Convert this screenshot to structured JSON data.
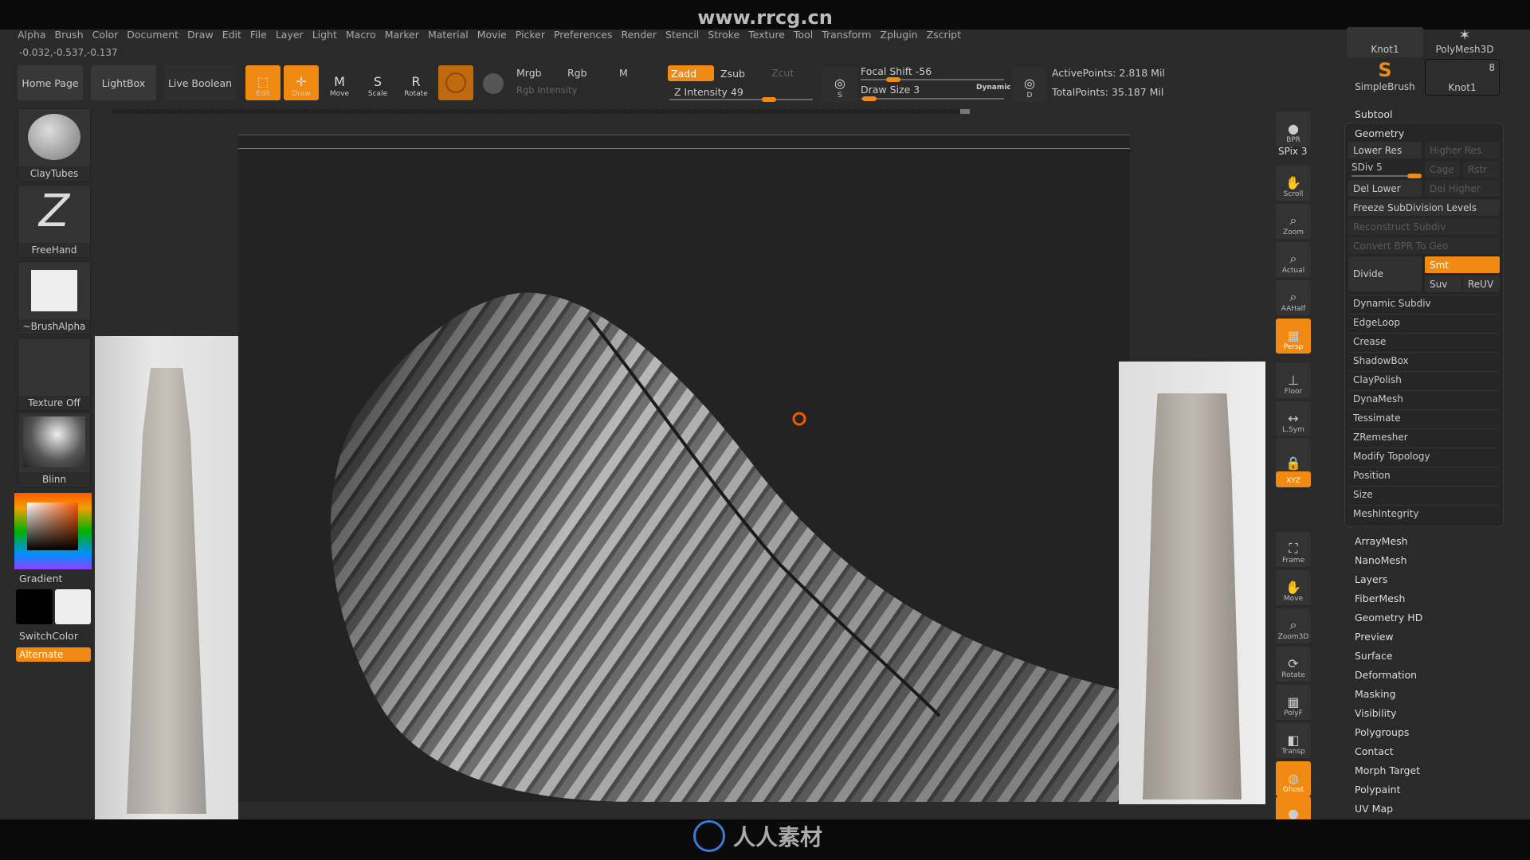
{
  "site": "www.rrcg.cn",
  "menu": [
    "Alpha",
    "Brush",
    "Color",
    "Document",
    "Draw",
    "Edit",
    "File",
    "Layer",
    "Light",
    "Macro",
    "Marker",
    "Material",
    "Movie",
    "Picker",
    "Preferences",
    "Render",
    "Stencil",
    "Stroke",
    "Texture",
    "Tool",
    "Transform",
    "Zplugin",
    "Zscript"
  ],
  "coords": "-0.032,-0.537,-0.137",
  "toolbar": {
    "home": "Home Page",
    "lightbox": "LightBox",
    "liveboolean": "Live Boolean",
    "edit": "Edit",
    "draw": "Draw",
    "move": "Move",
    "scale": "Scale",
    "rotate": "Rotate",
    "mrgb": "Mrgb",
    "rgb": "Rgb",
    "m": "M",
    "rgb_intensity": "Rgb Intensity",
    "zadd": "Zadd",
    "zsub": "Zsub",
    "zcut": "Zcut",
    "z_intensity": "Z Intensity 49",
    "focal_shift": "Focal Shift -56",
    "draw_size": "Draw Size 3",
    "dynamic": "Dynamic",
    "s": "S",
    "d": "D",
    "active_points": "ActivePoints: 2.818 Mil",
    "total_points": "TotalPoints: 35.187 Mil",
    "z_intensity_value": 49,
    "focal_shift_value": -56,
    "draw_size_value": 3
  },
  "left_shelf": {
    "brush": "ClayTubes",
    "stroke": "FreeHand",
    "alpha": "~BrushAlpha",
    "texture": "Texture Off",
    "material": "Blinn",
    "gradient": "Gradient",
    "switchcolor": "SwitchColor",
    "alternate": "Alternate"
  },
  "right_shelf": [
    {
      "label": "BPR",
      "icon": "bpr-icon"
    },
    {
      "label": "Scroll",
      "icon": "scroll-icon"
    },
    {
      "label": "Zoom",
      "icon": "zoom-icon"
    },
    {
      "label": "Actual",
      "icon": "actual-icon"
    },
    {
      "label": "AAHalf",
      "icon": "aahalf-icon"
    },
    {
      "label": "Persp",
      "icon": "persp-icon",
      "on": true
    },
    {
      "label": "Floor",
      "icon": "floor-icon"
    },
    {
      "label": "L.Sym",
      "icon": "lsym-icon"
    },
    {
      "label": "",
      "icon": "lock-icon"
    },
    {
      "label": "XYZ",
      "icon": "xyz-icon",
      "on": true
    },
    {
      "label": "Frame",
      "icon": "frame-icon"
    },
    {
      "label": "Move",
      "icon": "move-icon"
    },
    {
      "label": "Zoom3D",
      "icon": "zoom3d-icon"
    },
    {
      "label": "Rotate",
      "icon": "rotate-icon"
    },
    {
      "label": "PolyF",
      "icon": "polyf-icon"
    },
    {
      "label": "Transp",
      "icon": "transp-icon"
    },
    {
      "label": "Ghost",
      "icon": "ghost-icon",
      "on": true
    },
    {
      "label": "Solo",
      "icon": "solo-icon",
      "on": true
    }
  ],
  "spix": "SPix 3",
  "tools": {
    "knot1": "Knot1",
    "polymesh": "PolyMesh3D",
    "simplebrush": "SimpleBrush",
    "knot1b": "Knot1",
    "count": "8"
  },
  "subtool": "Subtool",
  "geometry": {
    "title": "Geometry",
    "lower_res": "Lower Res",
    "higher_res": "Higher Res",
    "sdiv": "SDiv 5",
    "sdiv_value": 5,
    "cage": "Cage",
    "rstr": "Rstr",
    "del_lower": "Del Lower",
    "del_higher": "Del Higher",
    "freeze": "Freeze SubDivision Levels",
    "reconstruct": "Reconstruct Subdiv",
    "convert": "Convert BPR To Geo",
    "divide": "Divide",
    "smt": "Smt",
    "suv": "Suv",
    "reuv": "ReUV",
    "items": [
      "Dynamic Subdiv",
      "EdgeLoop",
      "Crease",
      "ShadowBox",
      "ClayPolish",
      "DynaMesh",
      "Tessimate",
      "ZRemesher",
      "Modify Topology",
      "Position",
      "Size",
      "MeshIntegrity"
    ]
  },
  "tool_menu": [
    "ArrayMesh",
    "NanoMesh",
    "Layers",
    "FiberMesh",
    "Geometry HD",
    "Preview",
    "Surface",
    "Deformation",
    "Masking",
    "Visibility",
    "Polygroups",
    "Contact",
    "Morph Target",
    "Polypaint",
    "UV Map"
  ],
  "footer_logo": "人人素材",
  "accent": "#f08a12"
}
